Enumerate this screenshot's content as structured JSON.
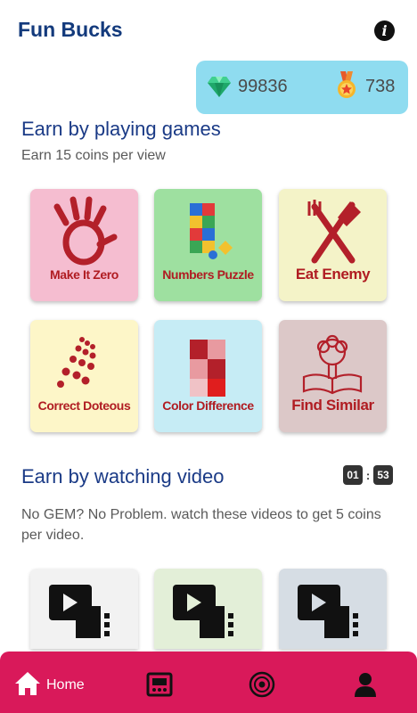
{
  "header": {
    "title": "Fun Bucks",
    "info_icon": "info-icon"
  },
  "wallet": {
    "gems": "99836",
    "coins": "738",
    "gem_icon": "diamond-icon",
    "coin_icon": "medal-icon"
  },
  "games_section": {
    "title": "Earn by playing games",
    "subtitle": "Earn 15 coins per view",
    "games": [
      {
        "label": "Make It Zero",
        "color": "#f5bdd0",
        "icon": "hand-icon"
      },
      {
        "label": "Numbers Puzzle",
        "color": "#9ee0a0",
        "icon": "puzzle-icon"
      },
      {
        "label": "Eat Enemy",
        "color": "#f4f3c8",
        "icon": "fork-knife-icon"
      },
      {
        "label": "Correct Doteous",
        "color": "#fdf6c8",
        "icon": "dots-icon"
      },
      {
        "label": "Color Difference",
        "color": "#c6ecf5",
        "icon": "color-grid-icon"
      },
      {
        "label": "Find Similar",
        "color": "#dcc8c8",
        "icon": "book-tree-icon"
      }
    ]
  },
  "video_section": {
    "title": "Earn by watching video",
    "subtitle": "No GEM? No Problem. watch these videos to get 5 coins per video.",
    "timer": {
      "minutes": "01",
      "seconds": "53"
    },
    "cards": [
      {
        "color": "#f2f2f2",
        "icon": "video-player-icon"
      },
      {
        "color": "#e3efd8",
        "icon": "video-player-icon"
      },
      {
        "color": "#d6dde4",
        "icon": "video-player-icon"
      }
    ]
  },
  "bottom_nav": {
    "home_label": "Home",
    "items": [
      "home-icon",
      "arcade-icon",
      "badge-icon",
      "profile-icon"
    ],
    "color": "#d9195a"
  }
}
